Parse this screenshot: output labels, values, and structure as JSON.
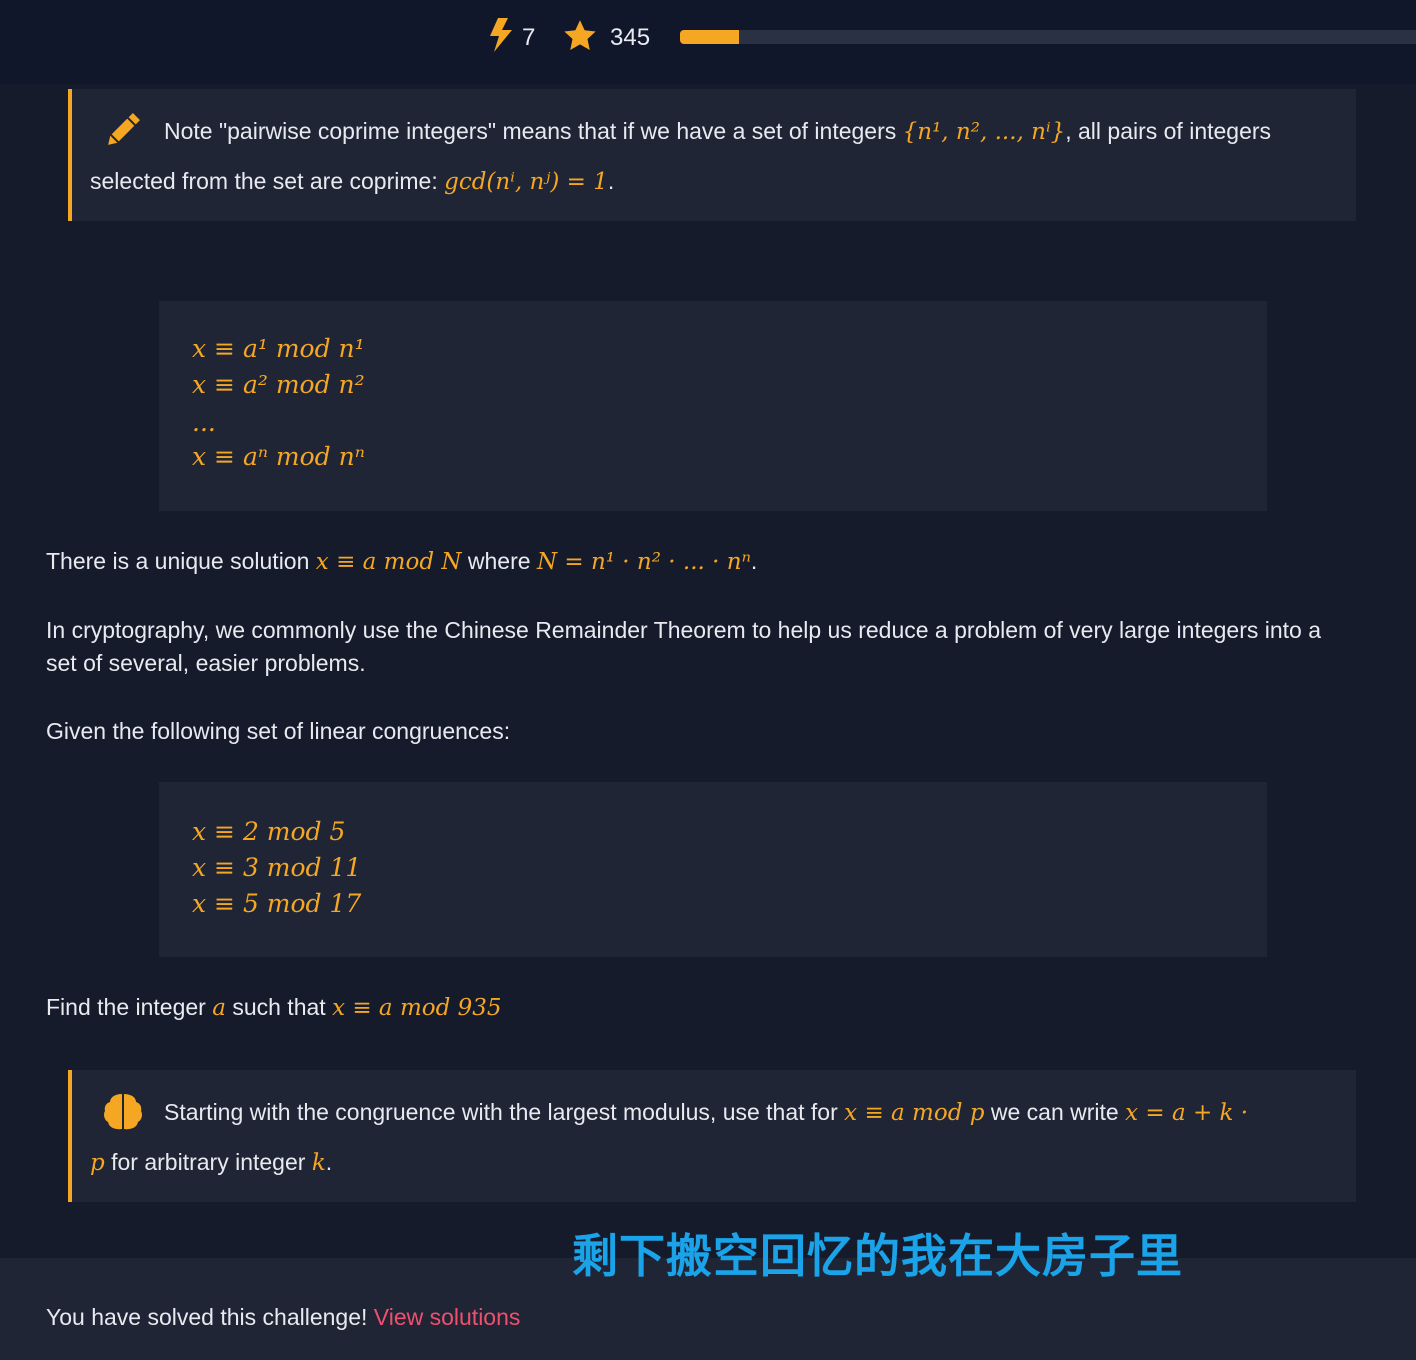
{
  "stats": {
    "streak": "7",
    "points": "345",
    "progress_percent": 8
  },
  "note_callout": {
    "icon": "pencil-icon",
    "line1_text": "Note \"pairwise coprime integers\" means that if we have a set of integers",
    "line1_math": "{n¹, n², ..., nⁱ}",
    "line1_suffix": ", all pairs of integers",
    "line2_text": "selected from the set are coprime:",
    "line2_math": "gcd(nⁱ, nʲ) = 1",
    "line2_suffix": "."
  },
  "general_system": [
    "x ≡ a¹ mod n¹",
    "x ≡ a² mod n²",
    "...",
    "x ≡ aⁿ mod nⁿ"
  ],
  "unique_solution": {
    "prefix": "There is a unique solution",
    "math1": "x ≡ a mod N",
    "middle": "where",
    "math2": "N = n¹ · n² · ... · nⁿ",
    "suffix": "."
  },
  "crypto_paragraph": {
    "line1": "In cryptography, we commonly use the Chinese Remainder Theorem to help us reduce a problem of very large integers into a",
    "line2": "set of several, easier problems."
  },
  "given_text": "Given the following set of linear congruences:",
  "congruences": [
    "x ≡ 2 mod 5",
    "x ≡ 3 mod 11",
    "x ≡ 5 mod 17"
  ],
  "find": {
    "prefix": "Find the integer",
    "var": "a",
    "middle": "such that",
    "math": "x ≡ a mod 935"
  },
  "hint_callout": {
    "icon": "brain-icon",
    "line1_text": "Starting with the congruence with the largest modulus, use that for",
    "line1_math": "x ≡ a mod p",
    "line1_middle": "we can write",
    "line1_math2": "x = a + k ·",
    "line2_math": "p",
    "line2_text": "for arbitrary integer",
    "line2_var": "k",
    "line2_suffix": "."
  },
  "overlay_caption": "剩下搬空回忆的我在大房子里",
  "footer": {
    "text": "You have solved this challenge!",
    "link": "View solutions"
  },
  "colors": {
    "accent": "#f5a623",
    "link": "#f0506e",
    "caption": "#1aa3e8",
    "background": "#151b2b",
    "panel": "#1f2535"
  }
}
